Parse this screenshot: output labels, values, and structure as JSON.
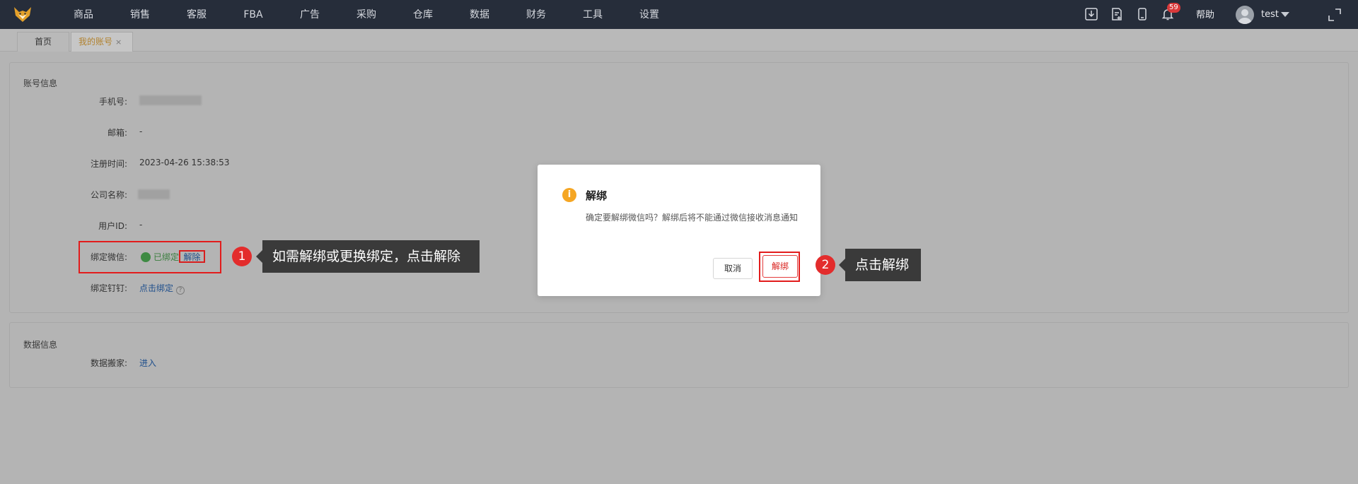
{
  "nav": {
    "items": [
      "商品",
      "销售",
      "客服",
      "FBA",
      "广告",
      "采购",
      "仓库",
      "数据",
      "财务",
      "工具",
      "设置"
    ]
  },
  "tools": {
    "notification_count": "59",
    "help_label": "帮助",
    "username": "test"
  },
  "tabs": {
    "home": "首页",
    "account": "我的账号",
    "close_symbol": "×"
  },
  "account_info": {
    "section_title": "账号信息",
    "phone_label": "手机号:",
    "email_label": "邮箱:",
    "email_value": "-",
    "register_time_label": "注册时间:",
    "register_time_value": "2023-04-26 15:38:53",
    "company_label": "公司名称:",
    "user_id_label": "用户ID:",
    "user_id_value": "-",
    "wechat_label": "绑定微信:",
    "wechat_status": "已绑定",
    "wechat_unbind": "解除",
    "dingtalk_label": "绑定钉钉:",
    "dingtalk_action": "点击绑定",
    "help_mark": "?"
  },
  "data_info": {
    "section_title": "数据信息",
    "migration_label": "数据搬家:",
    "migration_action": "进入"
  },
  "annotations": {
    "step1_number": "1",
    "step1_text": "如需解绑或更换绑定，点击解除",
    "step2_number": "2",
    "step2_text": "点击解绑"
  },
  "dialog": {
    "icon": "i",
    "title": "解绑",
    "body": "确定要解绑微信吗？解绑后将不能通过微信接收消息通知",
    "cancel_label": "取消",
    "confirm_label": "解绑"
  },
  "colors": {
    "topbar": "#262d3a",
    "highlight_red": "#e21c1c",
    "link_blue": "#1f4f8c",
    "warning_orange": "#f5a623",
    "tab_active_text": "#b1822f"
  }
}
